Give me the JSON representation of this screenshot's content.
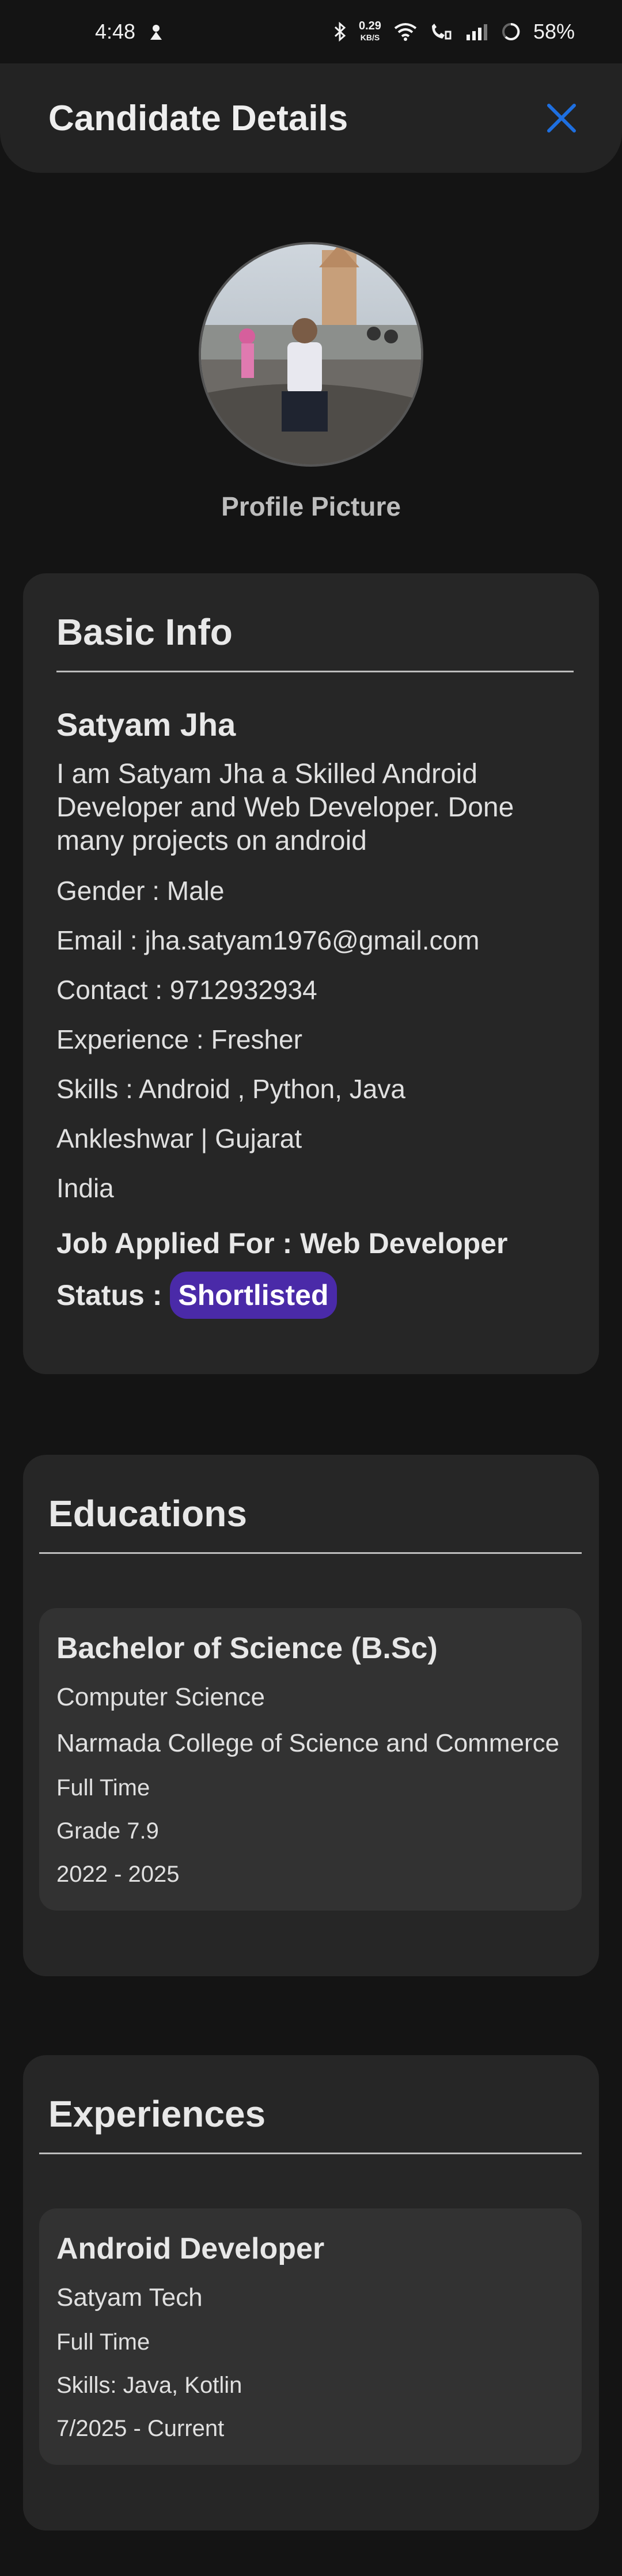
{
  "status_bar": {
    "time": "4:48",
    "net_speed": "0.29",
    "net_unit": "KB/S",
    "battery": "58%"
  },
  "header": {
    "title": "Candidate Details",
    "close_icon": "close-icon",
    "accent": "#1e6fe0"
  },
  "profile": {
    "caption": "Profile Picture"
  },
  "basic_info": {
    "heading": "Basic Info",
    "name": "Satyam Jha",
    "bio": "I am Satyam Jha a Skilled Android Developer and Web Developer. Done many projects on android",
    "gender": "Gender : Male",
    "email": "Email : jha.satyam1976@gmail.com",
    "contact": "Contact : 9712932934",
    "experience": "Experience : Fresher",
    "skills": "Skills : Android , Python, Java",
    "location": "Ankleshwar | Gujarat",
    "country": "India",
    "job_applied": "Job Applied For : Web Developer",
    "status_label": "Status :",
    "status_value": "Shortlisted",
    "status_color": "#4a2aa8"
  },
  "educations": {
    "heading": "Educations",
    "items": [
      {
        "degree": "Bachelor of Science (B.Sc)",
        "field": "Computer Science",
        "college": "Narmada College of Science and Commerce",
        "mode": "Full Time",
        "grade": "Grade  7.9",
        "years": "2022  -  2025"
      }
    ]
  },
  "experiences": {
    "heading": "Experiences",
    "items": [
      {
        "role": "Android Developer",
        "company": "Satyam Tech",
        "type": "Full Time",
        "skills": "Skills:  Java, Kotlin",
        "period": "7/2025  -  Current"
      }
    ]
  }
}
